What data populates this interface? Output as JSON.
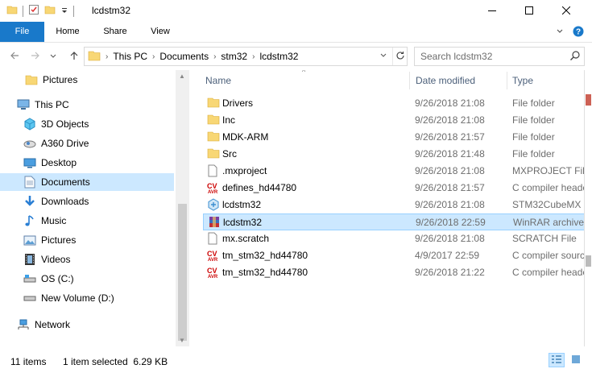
{
  "window": {
    "title": "lcdstm32"
  },
  "ribbon": {
    "tabs": [
      "File",
      "Home",
      "Share",
      "View"
    ]
  },
  "address": {
    "crumbs": [
      "This PC",
      "Documents",
      "stm32",
      "lcdstm32"
    ]
  },
  "search": {
    "placeholder": "Search lcdstm32"
  },
  "nav_pane": {
    "items": [
      {
        "label": "Pictures",
        "icon": "folder-icon"
      },
      {
        "label": "This PC",
        "icon": "computer-icon"
      },
      {
        "label": "3D Objects",
        "icon": "3d-objects-icon"
      },
      {
        "label": "A360 Drive",
        "icon": "cloud-drive-icon"
      },
      {
        "label": "Desktop",
        "icon": "desktop-icon"
      },
      {
        "label": "Documents",
        "icon": "documents-icon"
      },
      {
        "label": "Downloads",
        "icon": "downloads-icon"
      },
      {
        "label": "Music",
        "icon": "music-icon"
      },
      {
        "label": "Pictures",
        "icon": "pictures-icon"
      },
      {
        "label": "Videos",
        "icon": "videos-icon"
      },
      {
        "label": "OS (C:)",
        "icon": "drive-icon"
      },
      {
        "label": "New Volume (D:)",
        "icon": "drive-icon"
      },
      {
        "label": "Network",
        "icon": "network-icon"
      }
    ]
  },
  "columns": {
    "name": "Name",
    "date": "Date modified",
    "type": "Type"
  },
  "files": [
    {
      "name": "Drivers",
      "date": "9/26/2018 21:08",
      "type": "File folder",
      "icon": "folder-icon"
    },
    {
      "name": "Inc",
      "date": "9/26/2018 21:08",
      "type": "File folder",
      "icon": "folder-icon"
    },
    {
      "name": "MDK-ARM",
      "date": "9/26/2018 21:57",
      "type": "File folder",
      "icon": "folder-icon"
    },
    {
      "name": "Src",
      "date": "9/26/2018 21:48",
      "type": "File folder",
      "icon": "folder-icon"
    },
    {
      "name": ".mxproject",
      "date": "9/26/2018 21:08",
      "type": "MXPROJECT File",
      "icon": "blank-file-icon"
    },
    {
      "name": "defines_hd44780",
      "date": "9/26/2018 21:57",
      "type": "C compiler header",
      "icon": "c-header-icon"
    },
    {
      "name": "lcdstm32",
      "date": "9/26/2018 21:08",
      "type": "STM32CubeMX",
      "icon": "stm32cubemx-icon"
    },
    {
      "name": "lcdstm32",
      "date": "9/26/2018 22:59",
      "type": "WinRAR archive",
      "icon": "winrar-icon"
    },
    {
      "name": "mx.scratch",
      "date": "9/26/2018 21:08",
      "type": "SCRATCH File",
      "icon": "blank-file-icon"
    },
    {
      "name": "tm_stm32_hd44780",
      "date": "4/9/2017 22:59",
      "type": "C compiler source",
      "icon": "c-source-icon"
    },
    {
      "name": "tm_stm32_hd44780",
      "date": "9/26/2018 21:22",
      "type": "C compiler header",
      "icon": "c-header-icon"
    }
  ],
  "status": {
    "count": "11 items",
    "selection": "1 item selected  6.29 KB"
  },
  "colors": {
    "accent": "#1979ca",
    "selection": "#cce8ff",
    "selection_border": "#99d1ff",
    "folder": "#f8d775",
    "header_text": "#4c607a"
  }
}
